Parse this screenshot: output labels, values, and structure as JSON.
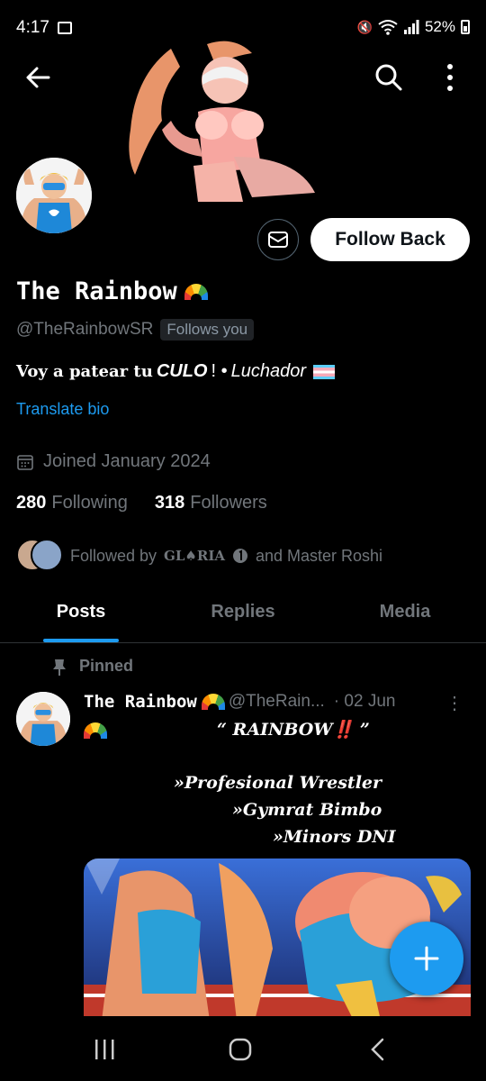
{
  "status_bar": {
    "time": "4:17",
    "battery": "52%"
  },
  "profile": {
    "name": "The Rainbow",
    "handle": "@TheRainbowSR",
    "follows_you": "Follows you",
    "follow_back": "Follow Back",
    "bio": {
      "part1": "Voy a patear tu",
      "part2": "CULO",
      "part3": "! •",
      "part4": "Luchador"
    },
    "translate": "Translate bio",
    "joined": "Joined January 2024",
    "following_count": "280",
    "following_label": "Following",
    "followers_count": "318",
    "followers_label": "Followers",
    "followed_by_prefix": "Followed by",
    "followed_by_name1": "GL♠RIA",
    "followed_by_mid": "and Master Roshi"
  },
  "tabs": [
    {
      "label": "Posts",
      "active": true
    },
    {
      "label": "Replies",
      "active": false
    },
    {
      "label": "Media",
      "active": false
    }
  ],
  "post": {
    "pinned_label": "Pinned",
    "author_name": "The Rainbow",
    "author_handle": "@TheRain...",
    "date": "· 02 Jun",
    "line1": "“ RAINBOW‼️ ”",
    "line2": "»Profesional Wrestler",
    "line3": "»Gymrat Bimbo",
    "line4": "»Minors DNI"
  },
  "colors": {
    "accent": "#1d9bf0",
    "background": "#000000",
    "muted": "#71767b"
  }
}
